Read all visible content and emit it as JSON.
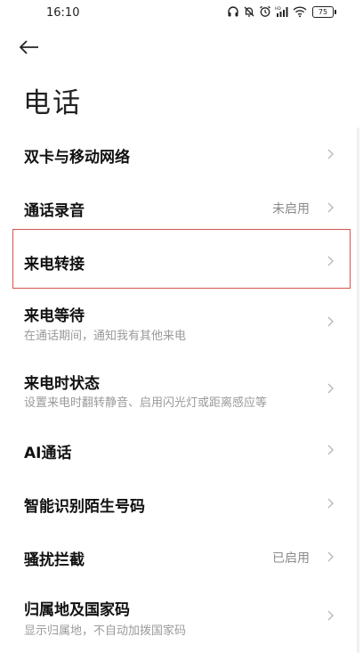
{
  "status_bar": {
    "time": "16:10",
    "battery": "75",
    "icons": [
      "headphone-icon",
      "mute-bell-icon",
      "alarm-icon",
      "signal-icon",
      "wifi-icon",
      "battery-icon"
    ]
  },
  "header": {
    "back_icon": "back-arrow-icon",
    "title": "电话"
  },
  "settings": {
    "items": [
      {
        "title": "双卡与移动网络",
        "subtitle": "",
        "value": ""
      },
      {
        "title": "通话录音",
        "subtitle": "",
        "value": "未启用"
      },
      {
        "title": "来电转接",
        "subtitle": "",
        "value": ""
      },
      {
        "title": "来电等待",
        "subtitle": "在通话期间，通知我有其他来电",
        "value": ""
      },
      {
        "title": "来电时状态",
        "subtitle": "设置来电时翻转静音、启用闪光灯或距离感应等",
        "value": ""
      },
      {
        "title": "AI通话",
        "subtitle": "",
        "value": ""
      },
      {
        "title": "智能识别陌生号码",
        "subtitle": "",
        "value": ""
      },
      {
        "title": "骚扰拦截",
        "subtitle": "",
        "value": "已启用"
      },
      {
        "title": "归属地及国家码",
        "subtitle": "显示归属地，不自动加拨国家码",
        "value": ""
      }
    ]
  },
  "colors": {
    "highlight_border": "#d9534f",
    "subtitle": "#9a9a9a"
  }
}
